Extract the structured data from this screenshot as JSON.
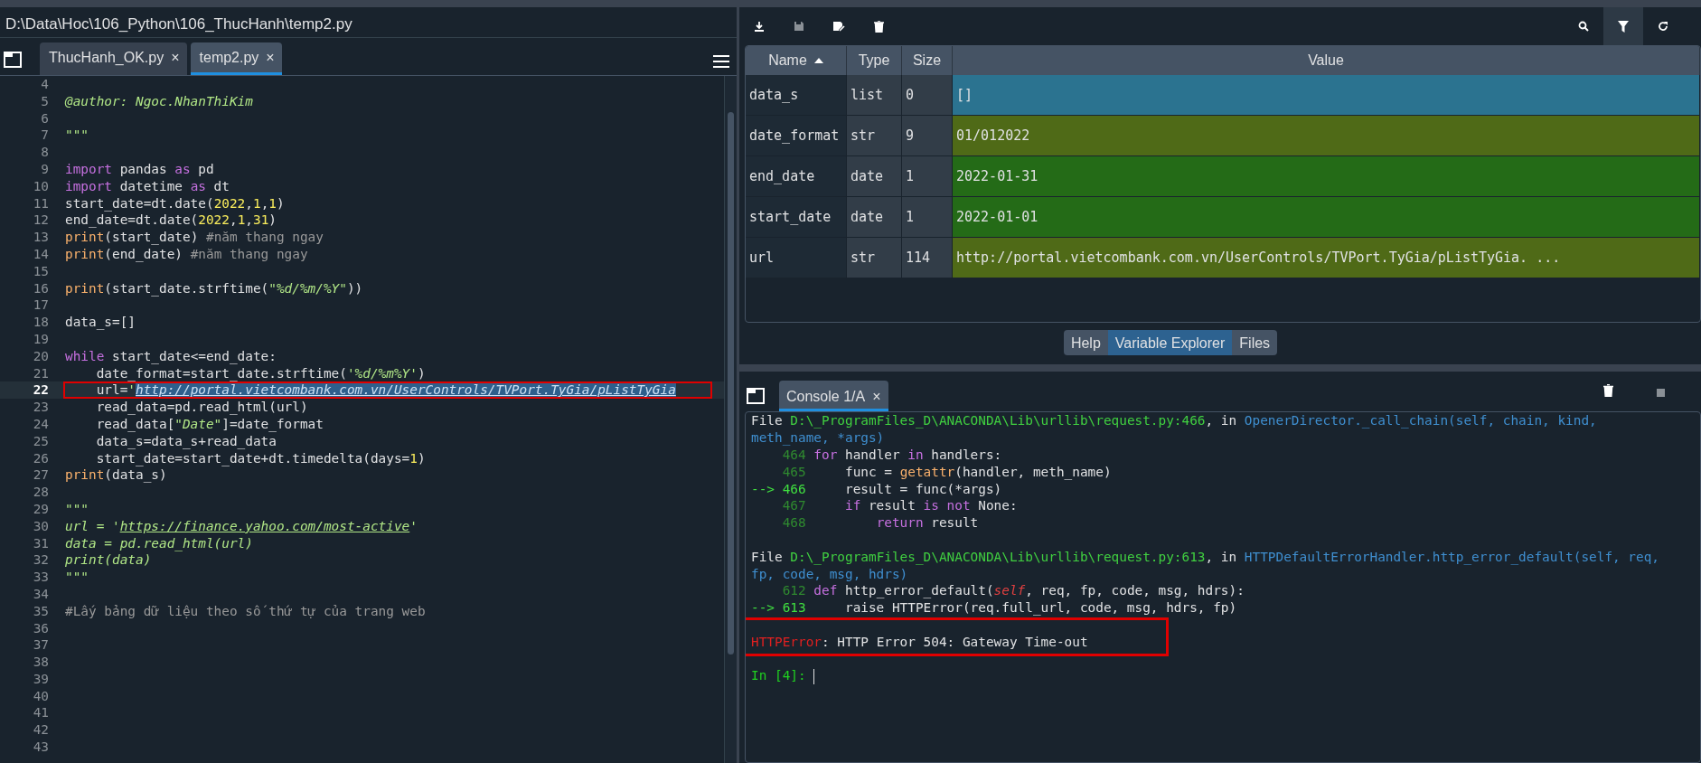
{
  "editor": {
    "path": "D:\\Data\\Hoc\\106_Python\\106_ThucHanh\\temp2.py",
    "tabs": [
      {
        "label": "ThucHanh_OK.py",
        "close": "×",
        "selected": false
      },
      {
        "label": "temp2.py",
        "close": "×",
        "selected": true
      }
    ],
    "lines": [
      {
        "number": "4"
      },
      {
        "number": "5",
        "tokens": [
          {
            "kind": "doc",
            "text": "@author: Ngoc.NhanThiKim"
          }
        ]
      },
      {
        "number": "6"
      },
      {
        "number": "7",
        "tokens": [
          {
            "kind": "doc",
            "text": "\"\"\""
          }
        ]
      },
      {
        "number": "8"
      },
      {
        "number": "9",
        "tokens": [
          {
            "kind": "keyword",
            "text": "import"
          },
          {
            "kind": "plain",
            "text": " pandas "
          },
          {
            "kind": "keyword",
            "text": "as"
          },
          {
            "kind": "plain",
            "text": " pd"
          }
        ]
      },
      {
        "number": "10",
        "tokens": [
          {
            "kind": "keyword",
            "text": "import"
          },
          {
            "kind": "plain",
            "text": " datetime "
          },
          {
            "kind": "keyword",
            "text": "as"
          },
          {
            "kind": "plain",
            "text": " dt"
          }
        ]
      },
      {
        "number": "11",
        "tokens": [
          {
            "kind": "plain",
            "text": "start_date=dt.date("
          },
          {
            "kind": "number",
            "text": "2022"
          },
          {
            "kind": "plain",
            "text": ","
          },
          {
            "kind": "number",
            "text": "1"
          },
          {
            "kind": "plain",
            "text": ","
          },
          {
            "kind": "number",
            "text": "1"
          },
          {
            "kind": "plain",
            "text": ")"
          }
        ]
      },
      {
        "number": "12",
        "tokens": [
          {
            "kind": "plain",
            "text": "end_date=dt.date("
          },
          {
            "kind": "number",
            "text": "2022"
          },
          {
            "kind": "plain",
            "text": ","
          },
          {
            "kind": "number",
            "text": "1"
          },
          {
            "kind": "plain",
            "text": ","
          },
          {
            "kind": "number",
            "text": "31"
          },
          {
            "kind": "plain",
            "text": ")"
          }
        ]
      },
      {
        "number": "13",
        "tokens": [
          {
            "kind": "builtin",
            "text": "print"
          },
          {
            "kind": "plain",
            "text": "(start_date) "
          },
          {
            "kind": "comment",
            "text": "#năm thang ngay"
          }
        ]
      },
      {
        "number": "14",
        "tokens": [
          {
            "kind": "builtin",
            "text": "print"
          },
          {
            "kind": "plain",
            "text": "(end_date) "
          },
          {
            "kind": "comment",
            "text": "#năm thang ngay"
          }
        ]
      },
      {
        "number": "15"
      },
      {
        "number": "16",
        "tokens": [
          {
            "kind": "builtin",
            "text": "print"
          },
          {
            "kind": "plain",
            "text": "(start_date.strftime("
          },
          {
            "kind": "string",
            "text": "\"%d/%m/%Y\""
          },
          {
            "kind": "plain",
            "text": "))"
          }
        ]
      },
      {
        "number": "17"
      },
      {
        "number": "18",
        "tokens": [
          {
            "kind": "plain",
            "text": "data_s=[]"
          }
        ]
      },
      {
        "number": "19"
      },
      {
        "number": "20",
        "tokens": [
          {
            "kind": "keyword",
            "text": "while"
          },
          {
            "kind": "plain",
            "text": " start_date<=end_date:"
          }
        ]
      },
      {
        "number": "21",
        "tokens": [
          {
            "kind": "plain",
            "text": "    date_format=start_date.strftime("
          },
          {
            "kind": "string",
            "text": "'%d/%m%Y'"
          },
          {
            "kind": "plain",
            "text": ")"
          }
        ]
      },
      {
        "number": "22",
        "current": true,
        "boxed": true,
        "tokens": [
          {
            "kind": "plain",
            "text": "    url="
          },
          {
            "kind": "string",
            "text": "'"
          },
          {
            "kind": "link",
            "text": "http://portal.vietcombank.com.vn/UserControls/TVPort.TyGia/pListTyGia"
          }
        ]
      },
      {
        "number": "23",
        "tokens": [
          {
            "kind": "plain",
            "text": "    read_data=pd.read_html(url)"
          }
        ]
      },
      {
        "number": "24",
        "tokens": [
          {
            "kind": "plain",
            "text": "    read_data["
          },
          {
            "kind": "string",
            "text": "\"Date\""
          },
          {
            "kind": "plain",
            "text": "]=date_format"
          }
        ]
      },
      {
        "number": "25",
        "tokens": [
          {
            "kind": "plain",
            "text": "    data_s=data_s+read_data"
          }
        ]
      },
      {
        "number": "26",
        "tokens": [
          {
            "kind": "plain",
            "text": "    start_date=start_date+dt.timedelta(days="
          },
          {
            "kind": "number",
            "text": "1"
          },
          {
            "kind": "plain",
            "text": ")"
          }
        ]
      },
      {
        "number": "27",
        "tokens": [
          {
            "kind": "builtin",
            "text": "print"
          },
          {
            "kind": "plain",
            "text": "(data_s)"
          }
        ]
      },
      {
        "number": "28"
      },
      {
        "number": "29",
        "tokens": [
          {
            "kind": "doc",
            "text": "\"\"\""
          }
        ]
      },
      {
        "number": "30",
        "tokens": [
          {
            "kind": "doc",
            "text": "url = '"
          },
          {
            "kind": "doclink",
            "text": "https://finance.yahoo.com/most-active"
          },
          {
            "kind": "doc",
            "text": "'"
          }
        ]
      },
      {
        "number": "31",
        "tokens": [
          {
            "kind": "doc",
            "text": "data = pd.read_html(url)"
          }
        ]
      },
      {
        "number": "32",
        "tokens": [
          {
            "kind": "doc",
            "text": "print(data)"
          }
        ]
      },
      {
        "number": "33",
        "tokens": [
          {
            "kind": "doc",
            "text": "\"\"\""
          }
        ]
      },
      {
        "number": "34"
      },
      {
        "number": "35",
        "tokens": [
          {
            "kind": "comment",
            "text": "#Lấy bảng dữ liệu theo số thứ tự của trang web"
          }
        ]
      },
      {
        "number": "36"
      },
      {
        "number": "37"
      },
      {
        "number": "38"
      },
      {
        "number": "39"
      },
      {
        "number": "40"
      },
      {
        "number": "41"
      },
      {
        "number": "42"
      },
      {
        "number": "43"
      }
    ]
  },
  "variables": {
    "columns": [
      {
        "label": "Name",
        "sorted": true
      },
      {
        "label": "Type",
        "sorted": false
      },
      {
        "label": "Size",
        "sorted": false
      },
      {
        "label": "Value",
        "sorted": false
      }
    ],
    "rows": [
      {
        "name": "data_s",
        "type": "list",
        "size": "0",
        "value": "[]",
        "color": "#2b7390"
      },
      {
        "name": "date_format",
        "type": "str",
        "size": "9",
        "value": "01/012022",
        "color": "#4f6a17"
      },
      {
        "name": "end_date",
        "type": "date",
        "size": "1",
        "value": "2022-01-31",
        "color": "#246b17"
      },
      {
        "name": "start_date",
        "type": "date",
        "size": "1",
        "value": "2022-01-01",
        "color": "#246b17"
      },
      {
        "name": "url",
        "type": "str",
        "size": "114",
        "value": "http://portal.vietcombank.com.vn/UserControls/TVPort.TyGia/pListTyGia. ...",
        "color": "#4f6a17"
      }
    ]
  },
  "pane_tabs": [
    {
      "label": "Help",
      "selected": false
    },
    {
      "label": "Variable Explorer",
      "selected": true
    },
    {
      "label": "Files",
      "selected": false
    }
  ],
  "console": {
    "tab": {
      "label": "Console 1/A",
      "close": "×"
    },
    "lines": [
      {
        "tokens": [
          {
            "kind": "plain",
            "text": "File "
          },
          {
            "kind": "path",
            "text": "D:\\_ProgramFiles_D\\ANACONDA\\Lib\\urllib\\request.py:466"
          },
          {
            "kind": "plain",
            "text": ", in "
          },
          {
            "kind": "func",
            "text": "OpenerDirector._call_chain(self, chain, kind,"
          }
        ]
      },
      {
        "tokens": [
          {
            "kind": "func",
            "text": "meth_name, *args)"
          }
        ]
      },
      {
        "tokens": [
          {
            "kind": "lineno",
            "text": "    464 "
          },
          {
            "kind": "keyword",
            "text": "for"
          },
          {
            "kind": "plain",
            "text": " handler "
          },
          {
            "kind": "keyword",
            "text": "in"
          },
          {
            "kind": "plain",
            "text": " handlers:"
          }
        ]
      },
      {
        "tokens": [
          {
            "kind": "lineno",
            "text": "    465 "
          },
          {
            "kind": "plain",
            "text": "    func = "
          },
          {
            "kind": "builtin",
            "text": "getattr"
          },
          {
            "kind": "plain",
            "text": "(handler, meth_name)"
          }
        ]
      },
      {
        "tokens": [
          {
            "kind": "arrow",
            "text": "--> 466 "
          },
          {
            "kind": "plain",
            "text": "    result = func(*args)"
          }
        ]
      },
      {
        "tokens": [
          {
            "kind": "lineno",
            "text": "    467     "
          },
          {
            "kind": "keyword",
            "text": "if"
          },
          {
            "kind": "plain",
            "text": " result "
          },
          {
            "kind": "keyword",
            "text": "is not"
          },
          {
            "kind": "plain",
            "text": " None:"
          }
        ]
      },
      {
        "tokens": [
          {
            "kind": "lineno",
            "text": "    468         "
          },
          {
            "kind": "keyword",
            "text": "return"
          },
          {
            "kind": "plain",
            "text": " result"
          }
        ]
      },
      {
        "gap_before": true,
        "tokens": [
          {
            "kind": "plain",
            "text": "File "
          },
          {
            "kind": "path",
            "text": "D:\\_ProgramFiles_D\\ANACONDA\\Lib\\urllib\\request.py:613"
          },
          {
            "kind": "plain",
            "text": ", in "
          },
          {
            "kind": "func",
            "text": "HTTPDefaultErrorHandler.http_error_default(self, req,"
          }
        ]
      },
      {
        "tokens": [
          {
            "kind": "func",
            "text": "fp, code, msg, hdrs)"
          }
        ]
      },
      {
        "tokens": [
          {
            "kind": "lineno",
            "text": "    612 "
          },
          {
            "kind": "keyword",
            "text": "def"
          },
          {
            "kind": "plain",
            "text": " http_error_default("
          },
          {
            "kind": "self",
            "text": "self"
          },
          {
            "kind": "plain",
            "text": ", req, fp, code, msg, hdrs):"
          }
        ]
      },
      {
        "tokens": [
          {
            "kind": "arrow",
            "text": "--> 613 "
          },
          {
            "kind": "plain",
            "text": "    raise HTTPError(req.full_url, code, msg, hdrs, fp)"
          }
        ]
      },
      {
        "gap_before": true,
        "boxed": true,
        "tokens": [
          {
            "kind": "error",
            "text": "HTTPError"
          },
          {
            "kind": "plain",
            "text": ": HTTP Error 504: Gateway Time-out"
          }
        ]
      },
      {
        "gap_before": true,
        "prompt": true,
        "tokens": [
          {
            "kind": "prompt",
            "text": "In [4]: "
          }
        ]
      }
    ]
  }
}
